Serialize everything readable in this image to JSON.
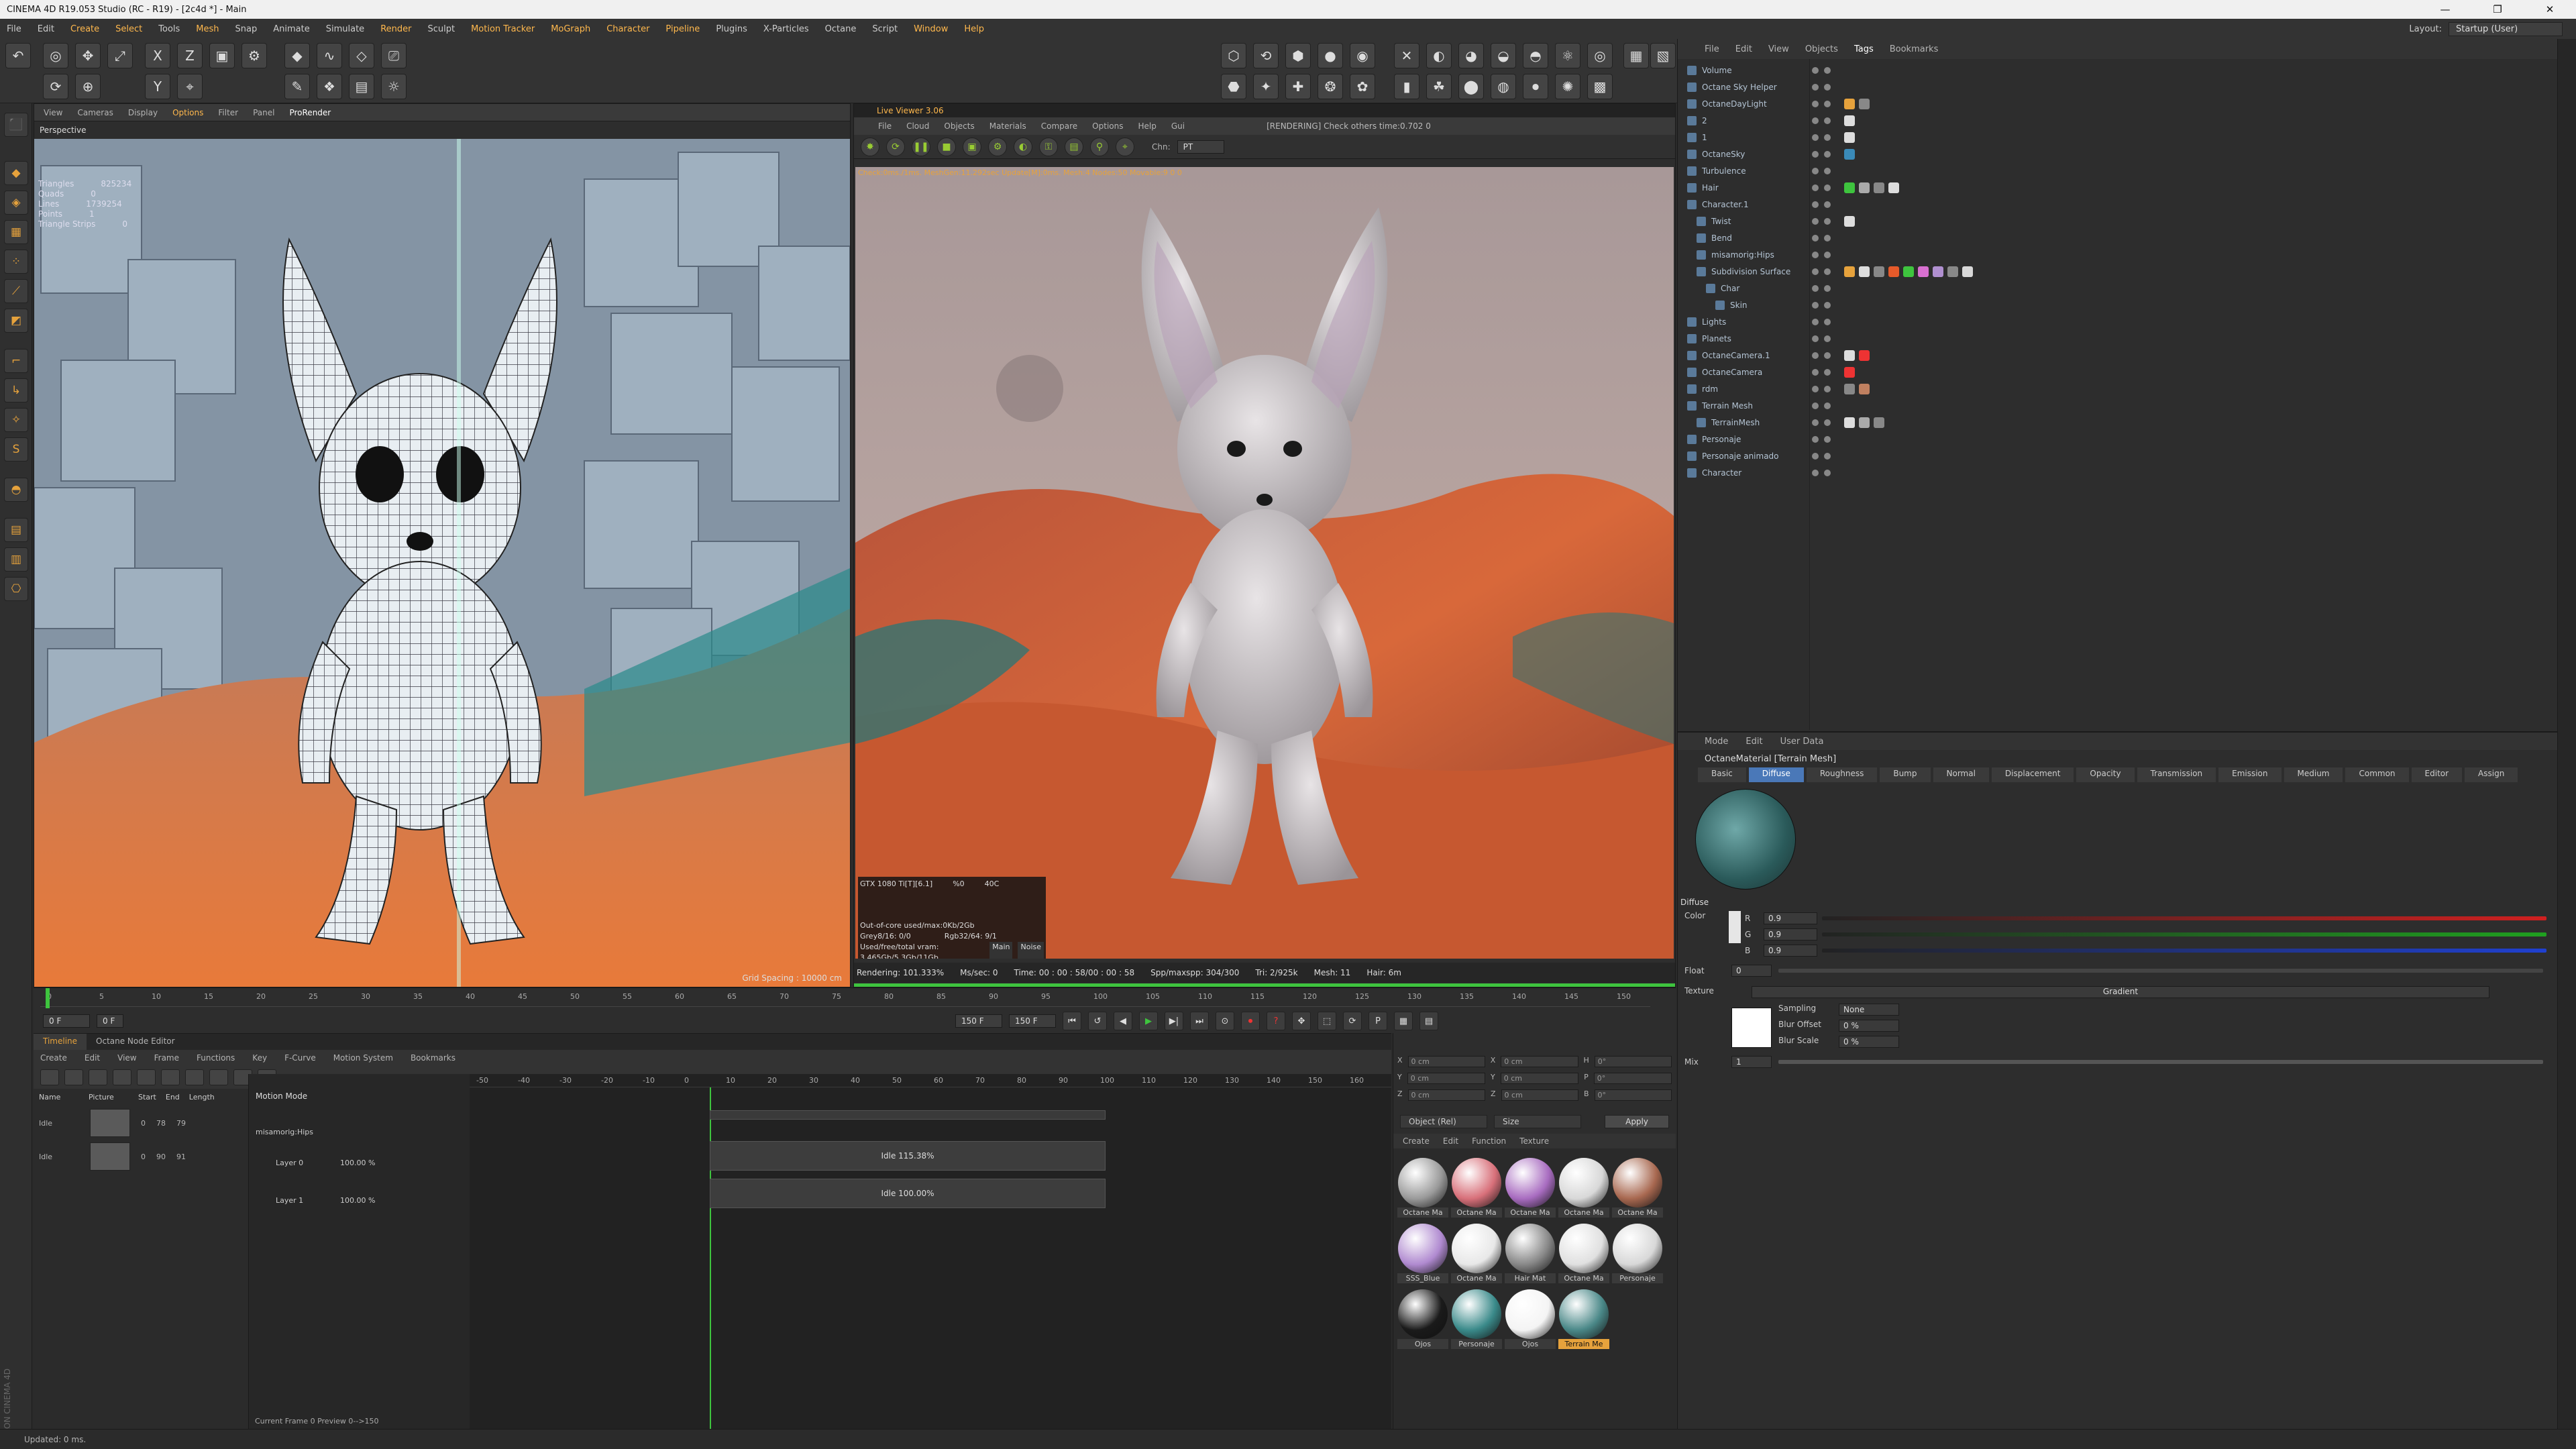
{
  "window": {
    "title": "CINEMA 4D R19.053 Studio (RC - R19) - [2c4d *] - Main",
    "controls": [
      "—",
      "❐",
      "✕"
    ]
  },
  "menubar": {
    "items": [
      "File",
      "Edit",
      "Create",
      "Select",
      "Tools",
      "Mesh",
      "Snap",
      "Animate",
      "Simulate",
      "Render",
      "Sculpt",
      "Motion Tracker",
      "MoGraph",
      "Character",
      "Pipeline",
      "Plugins",
      "X-Particles",
      "Octane",
      "Script",
      "Window",
      "Help"
    ],
    "layout_label": "Layout:",
    "layout_value": "Startup (User)"
  },
  "viewport": {
    "menu": [
      "View",
      "Cameras",
      "Display",
      "Options",
      "Filter",
      "Panel",
      "ProRender"
    ],
    "title": "Perspective",
    "stats": [
      {
        "k": "Triangles",
        "v": "825234"
      },
      {
        "k": "Quads",
        "v": "0"
      },
      {
        "k": "Lines",
        "v": "1739254"
      },
      {
        "k": "Points",
        "v": "1"
      },
      {
        "k": "Triangle Strips",
        "v": "0"
      }
    ],
    "grid_spacing": "Grid Spacing : 10000 cm"
  },
  "live_viewer": {
    "title": "Live Viewer 3.06",
    "menu": [
      "File",
      "Cloud",
      "Objects",
      "Materials",
      "Compare",
      "Options",
      "Help",
      "Gui"
    ],
    "status": "[RENDERING] Check others time:0.702  0",
    "chn_label": "Chn:",
    "chn_value": "PT",
    "info_line": "Check:0ms./1ms. MeshGen:11.292sec Update[M]:0ms. Mesh:4 Nodes:50 Movable:9  0 0",
    "gpu": {
      "name": "GTX 1080 Ti[T][6.1]",
      "pct": "%0",
      "temp": "40C"
    },
    "mem": [
      "Out-of-core used/max:0Kb/2Gb",
      "Grey8/16: 0/0",
      "Rgb32/64: 9/1",
      "Used/free/total vram: 3.465Gb/5.3Gb/11Gb"
    ],
    "tabs": [
      "Main",
      "Noise"
    ],
    "bottom": [
      "Rendering: 101.333%",
      "Ms/sec: 0",
      "Time: 00 : 00 : 58/00 : 00 : 58",
      "Spp/maxspp: 304/300",
      "Tri: 2/925k",
      "Mesh: 11",
      "Hair: 6m"
    ]
  },
  "timeline": {
    "ticks": [
      "0",
      "5",
      "10",
      "15",
      "20",
      "25",
      "30",
      "35",
      "40",
      "45",
      "50",
      "55",
      "60",
      "65",
      "70",
      "75",
      "80",
      "85",
      "90",
      "95",
      "100",
      "105",
      "110",
      "115",
      "120",
      "125",
      "130",
      "135",
      "140",
      "145",
      "150"
    ],
    "current": "0 F",
    "start": "0 F",
    "end": "150 F",
    "end2": "150 F",
    "end_mark": "0 F",
    "progress": 0.0
  },
  "motion": {
    "tabs": [
      "Timeline",
      "Octane Node Editor"
    ],
    "menu": [
      "Create",
      "Edit",
      "View",
      "Frame",
      "Functions",
      "Key",
      "F-Curve",
      "Motion System",
      "Bookmarks"
    ],
    "cols": [
      "Name",
      "Picture",
      "Start",
      "End",
      "Length"
    ],
    "rows": [
      {
        "name": "Idle",
        "start": "0",
        "end": "78",
        "length": "79"
      },
      {
        "name": "Idle",
        "start": "0",
        "end": "90",
        "length": "91"
      }
    ],
    "mode": "Motion Mode",
    "group": "misamorig:Hips",
    "layers": [
      {
        "name": "Layer 0",
        "pct": "100.00 %"
      },
      {
        "name": "Layer 1",
        "pct": "100.00 %"
      }
    ],
    "clips": [
      {
        "label": "Idle 115.38%",
        "start": "0",
        "end": "90"
      },
      {
        "label": "Idle 100.00%",
        "start": "0",
        "end": "90"
      }
    ],
    "ruler": [
      "-50",
      "-40",
      "-30",
      "-20",
      "-10",
      "0",
      "10",
      "20",
      "30",
      "40",
      "50",
      "60",
      "70",
      "80",
      "90",
      "100",
      "110",
      "120",
      "130",
      "140",
      "150",
      "160"
    ],
    "current": "Current Frame  0  Preview  0-->150"
  },
  "coords": {
    "rows": [
      [
        "X",
        "0 cm",
        "X",
        "0 cm",
        "H",
        "0°"
      ],
      [
        "Y",
        "0 cm",
        "Y",
        "0 cm",
        "P",
        "0°"
      ],
      [
        "Z",
        "0 cm",
        "Z",
        "0 cm",
        "B",
        "0°"
      ]
    ],
    "select": "Object (Rel)",
    "size": "Size",
    "apply": "Apply"
  },
  "materials": {
    "menu": [
      "Create",
      "Edit",
      "Function",
      "Texture"
    ],
    "items": [
      {
        "label": "Octane Ma",
        "color": "#9a9a9a"
      },
      {
        "label": "Octane Ma",
        "color": "#d8707a"
      },
      {
        "label": "Octane Ma",
        "color": "#a86cc0"
      },
      {
        "label": "Octane Ma",
        "color": "#d8d8d8"
      },
      {
        "label": "Octane Ma",
        "color": "#a86850"
      },
      {
        "label": "SSS_Blue",
        "color": "#b08ad0"
      },
      {
        "label": "Octane Ma",
        "color": "#e8e8e8"
      },
      {
        "label": "Hair Mat",
        "color": "#888888"
      },
      {
        "label": "Octane Ma",
        "color": "#e0e0e0"
      },
      {
        "label": "Personaje",
        "color": "#d8d8d8"
      },
      {
        "label": "Ojos",
        "color": "#1a1a1a"
      },
      {
        "label": "Personaje",
        "color": "#3a8a8a"
      },
      {
        "label": "Ojos",
        "color": "#f4f4f4"
      },
      {
        "label": "Terrain Me",
        "color": "#4a8888",
        "selected": true
      }
    ]
  },
  "objects": {
    "menu": [
      "File",
      "Edit",
      "View",
      "Objects",
      "Tags",
      "Bookmarks"
    ],
    "items": [
      "Volume",
      "Octane Sky Helper",
      "OctaneDayLight",
      "2",
      "1",
      "OctaneSky",
      "Turbulence",
      "Hair",
      "Character.1",
      "Twist",
      "Bend",
      "misamorig:Hips",
      "Subdivision Surface",
      "Char",
      "Skin",
      "Lights",
      "Planets",
      "OctaneCamera.1",
      "OctaneCamera",
      "rdm",
      "Terrain Mesh",
      "TerrainMesh",
      "Personaje",
      "Personaje animado",
      "Character"
    ]
  },
  "attributes": {
    "menu": [
      "Mode",
      "Edit",
      "User Data"
    ],
    "material_name": "OctaneMaterial [Terrain Mesh]",
    "tabs": [
      "Basic",
      "Diffuse",
      "Roughness",
      "Bump",
      "Normal",
      "Displacement",
      "Opacity",
      "Transmission",
      "Emission",
      "Medium",
      "Common",
      "Editor",
      "Assign"
    ],
    "section": "Diffuse",
    "color_label": "Color",
    "rgb": [
      {
        "c": "R",
        "v": "0.9",
        "col": "#d02020"
      },
      {
        "c": "G",
        "v": "0.9",
        "col": "#20a020"
      },
      {
        "c": "B",
        "v": "0.9",
        "col": "#2040d0"
      }
    ],
    "float_label": "Float",
    "float_value": "0",
    "texture_label": "Texture",
    "texture_name": "Gradient",
    "sampling_label": "Sampling",
    "sampling_value": "None",
    "blur_offset_label": "Blur Offset",
    "blur_offset": "0 %",
    "blur_scale_label": "Blur Scale",
    "blur_scale": "0 %",
    "mix_label": "Mix",
    "mix_value": "1"
  },
  "status": "Updated: 0 ms.",
  "maxon": "MAXON CINEMA 4D"
}
